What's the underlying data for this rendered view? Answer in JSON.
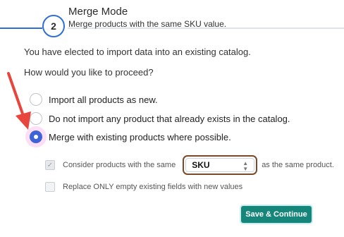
{
  "step": {
    "number": "2",
    "title": "Merge Mode",
    "subtitle": "Merge products with the same SKU value."
  },
  "intro_text": "You have elected to import data into an existing catalog.",
  "question_text": "How would you like to proceed?",
  "options": [
    {
      "label": "Import all products as new.",
      "selected": false
    },
    {
      "label": "Do not import any product that already exists in the catalog.",
      "selected": false
    },
    {
      "label": "Merge with existing products where possible.",
      "selected": true
    }
  ],
  "merge_settings": {
    "consider_prefix": "Consider products with the same",
    "consider_suffix": "as the same product.",
    "consider_checked": true,
    "field_select_value": "SKU",
    "replace_label": "Replace ONLY empty existing fields with new values",
    "replace_checked": false
  },
  "save_button_label": "Save & Continue",
  "colors": {
    "accent_blue": "#3c64d6",
    "button_teal": "#16857a",
    "arrow_red": "#e8453c",
    "select_outline": "#7a4a2a"
  },
  "icons": {
    "checkmark": "checkmark-icon",
    "select_chevron": "chevron-updown-icon",
    "annotation": "red-arrow-icon"
  }
}
